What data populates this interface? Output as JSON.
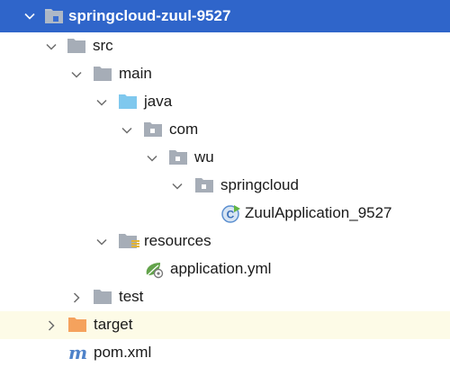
{
  "tree": {
    "nodes": [
      {
        "label": "springcloud-zuul-9527",
        "state": "expanded",
        "icon": "module-folder-icon",
        "selected": true
      },
      {
        "label": "src",
        "state": "expanded",
        "icon": "folder-icon"
      },
      {
        "label": "main",
        "state": "expanded",
        "icon": "folder-icon"
      },
      {
        "label": "java",
        "state": "expanded",
        "icon": "source-root-folder-icon"
      },
      {
        "label": "com",
        "state": "expanded",
        "icon": "package-icon"
      },
      {
        "label": "wu",
        "state": "expanded",
        "icon": "package-icon"
      },
      {
        "label": "springcloud",
        "state": "expanded",
        "icon": "package-icon"
      },
      {
        "label": "ZuulApplication_9527",
        "state": "leaf",
        "icon": "spring-boot-class-icon"
      },
      {
        "label": "resources",
        "state": "expanded",
        "icon": "resources-root-folder-icon"
      },
      {
        "label": "application.yml",
        "state": "leaf",
        "icon": "spring-yaml-file-icon"
      },
      {
        "label": "test",
        "state": "collapsed",
        "icon": "folder-icon"
      },
      {
        "label": "target",
        "state": "collapsed",
        "icon": "excluded-folder-icon",
        "highlighted": true
      },
      {
        "label": "pom.xml",
        "state": "leaf",
        "icon": "maven-file-icon"
      }
    ]
  },
  "colors": {
    "selection": "#2f65ca",
    "highlight_row": "#fdfbe7",
    "folder": "#a6adb7",
    "source_root": "#7fc8ee",
    "excluded": "#f5a25d",
    "maven": "#4e82c9",
    "spring": "#63a34b"
  }
}
